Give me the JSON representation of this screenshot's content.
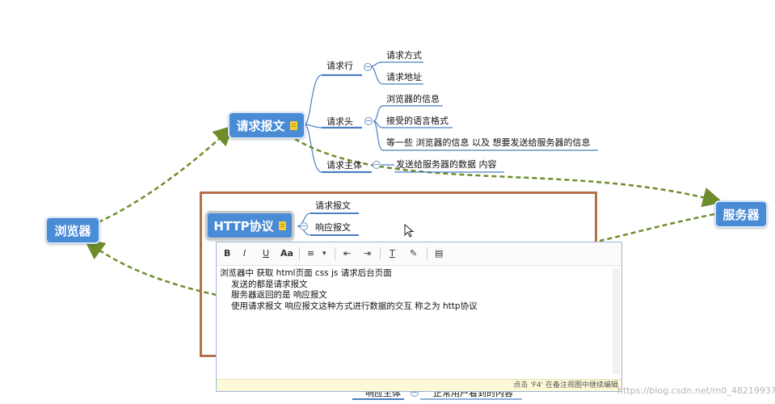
{
  "nodes": {
    "browser": "浏览器",
    "server": "服务器",
    "request_message": "请求报文",
    "http_protocol": "HTTP协议"
  },
  "request": {
    "line": {
      "label": "请求行",
      "children": [
        "请求方式",
        "请求地址"
      ]
    },
    "header": {
      "label": "请求头",
      "children": [
        "浏览器的信息",
        "接受的语言格式",
        "等一些 浏览器的信息 以及 想要发送给服务器的信息"
      ]
    },
    "body": {
      "label": "请求主体",
      "children": [
        "发送给服务器的数据 内容"
      ]
    }
  },
  "http": {
    "children": [
      "请求报文",
      "响应报文"
    ]
  },
  "response_partial": {
    "label": "响应主体",
    "child": "正常用户看到的内容"
  },
  "note_editor": {
    "toolbar": [
      "B",
      "I",
      "U",
      "Aa",
      "≡",
      "▾",
      "⇤",
      "⇥",
      "T",
      "✎",
      "▤"
    ],
    "lines": [
      "浏览器中 获取 html页面 css js 请求后台页面",
      "发送的都是请求报文",
      "服务器返回的是 响应报文",
      "使用请求报文 响应报文这种方式进行数据的交互 称之为 http协议"
    ],
    "status": "点击 'F4' 在备注视图中继续编辑"
  },
  "watermark": "https://blog.csdn.net/m0_48219937",
  "colors": {
    "node": "#4a8bd6",
    "arrow": "#6e8d2a",
    "frame": "#b5704c",
    "branch": "#4a7fc0"
  }
}
